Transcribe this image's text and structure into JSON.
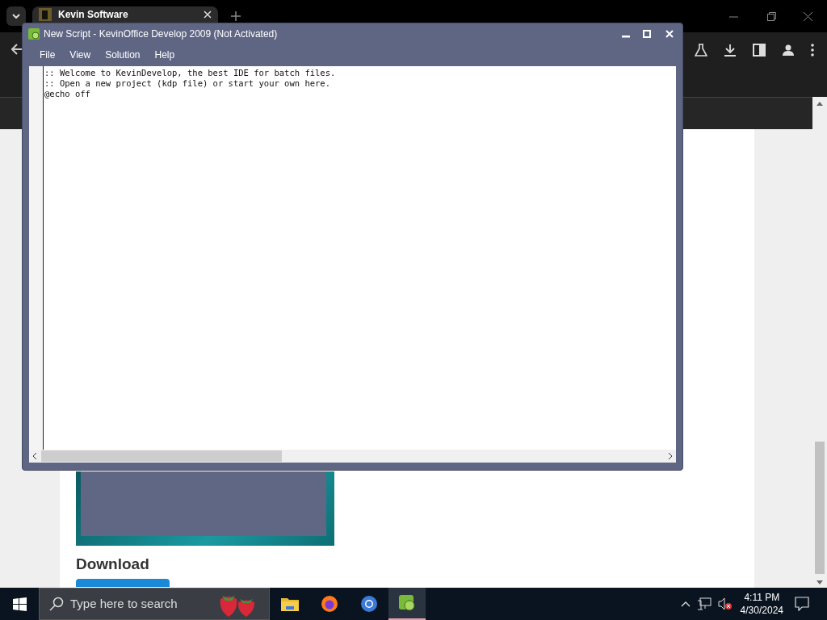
{
  "browser": {
    "tab": {
      "title": "Kevin Software",
      "selected": true
    }
  },
  "page": {
    "heading": "Download"
  },
  "ide": {
    "title": "New Script - KevinOffice Develop 2009 (Not Activated)",
    "menu": [
      "File",
      "View",
      "Solution",
      "Help"
    ],
    "lines": [
      ":: Welcome to KevinDevelop, the best IDE for batch files.",
      ":: Open a new project (kdp file) or start your own here.",
      "@echo off"
    ]
  },
  "taskbar": {
    "search": {
      "placeholder": "Type here to search"
    },
    "time": "4:11 PM",
    "date": "4/30/2024"
  }
}
